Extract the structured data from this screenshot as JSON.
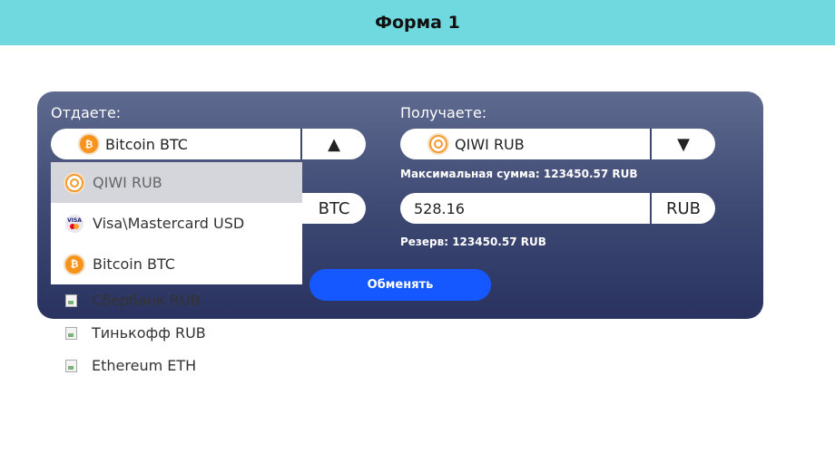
{
  "header": {
    "title": "Форма 1"
  },
  "give": {
    "label": "Отдаете:",
    "selected": {
      "name": "Bitcoin BTC",
      "icon": "bitcoin-icon"
    },
    "arrow": "▲",
    "currency_code": "BTC"
  },
  "receive": {
    "label": "Получаете:",
    "selected": {
      "name": "QIWI RUB",
      "icon": "qiwi-icon"
    },
    "arrow": "▼",
    "max_sum": "Максимальная сумма: 123450.57 RUB",
    "amount": "528.16",
    "currency_code": "RUB",
    "reserve": "Резерв: 123450.57 RUB"
  },
  "exchange_button": "Обменять",
  "dropdown": {
    "options": [
      {
        "name": "QIWI RUB",
        "icon": "qiwi-icon"
      },
      {
        "name": "Visa\\Mastercard USD",
        "icon": "visa-mastercard-icon"
      },
      {
        "name": "Bitcoin BTC",
        "icon": "bitcoin-icon"
      },
      {
        "name": "Сбербанк RUB",
        "icon": "broken-image-icon"
      },
      {
        "name": "Тинькофф RUB",
        "icon": "broken-image-icon"
      },
      {
        "name": "Ethereum ETH",
        "icon": "broken-image-icon"
      }
    ],
    "highlighted_index": 0
  },
  "colors": {
    "header_bg": "#70d9df",
    "button": "#1558ff",
    "card_top": "#5f6a8f",
    "card_bottom": "#2a3360"
  }
}
